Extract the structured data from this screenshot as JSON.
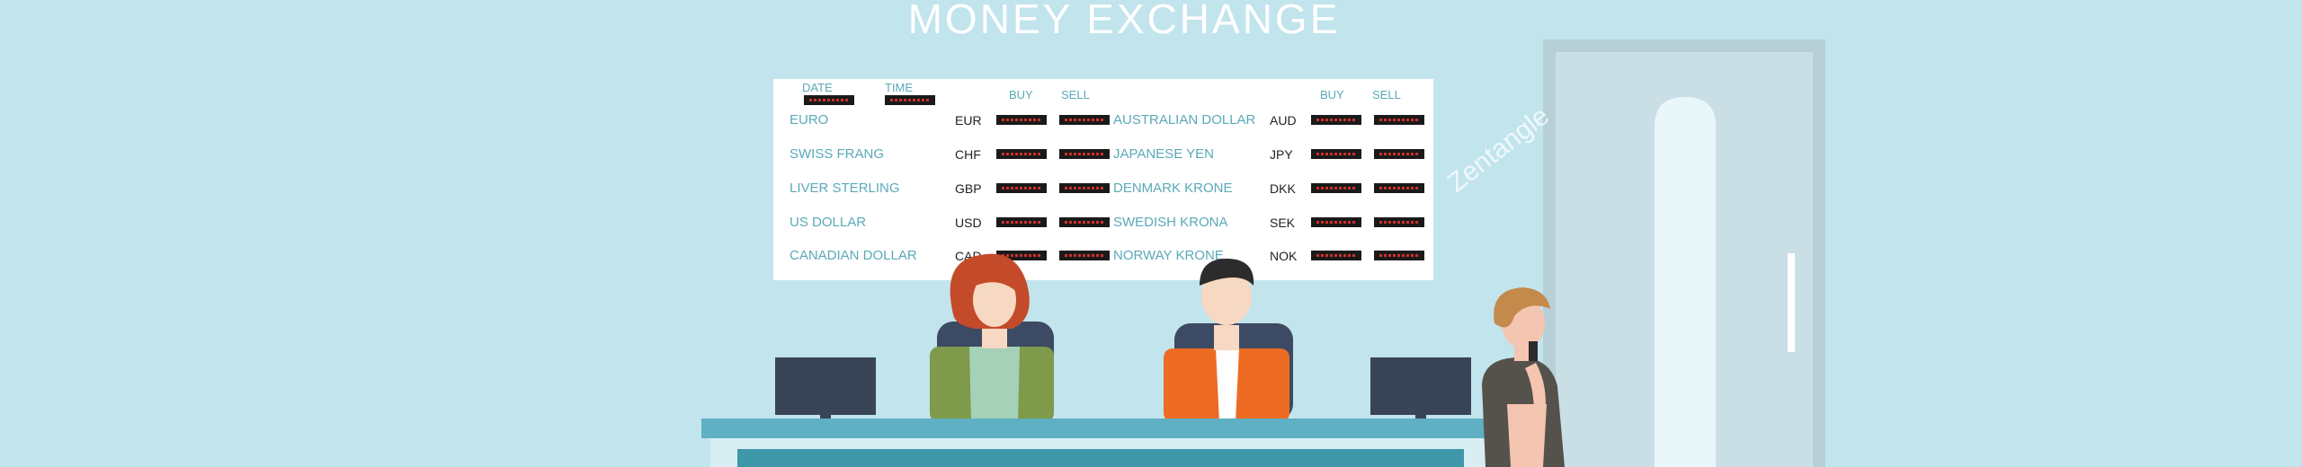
{
  "title": "MONEY EXCHANGE",
  "watermark": "Zentangle",
  "board": {
    "date_label": "DATE",
    "time_label": "TIME",
    "buy_label": "BUY",
    "sell_label": "SELL",
    "left_rows": [
      {
        "name": "EURO",
        "code": "EUR"
      },
      {
        "name": "SWISS FRANG",
        "code": "CHF"
      },
      {
        "name": "LIVER STERLING",
        "code": "GBP"
      },
      {
        "name": "US DOLLAR",
        "code": "USD"
      },
      {
        "name": "CANADIAN DOLLAR",
        "code": "CAD"
      }
    ],
    "right_rows": [
      {
        "name": "AUSTRALIAN DOLLAR",
        "code": "AUD"
      },
      {
        "name": "JAPANESE YEN",
        "code": "JPY"
      },
      {
        "name": "DENMARK KRONE",
        "code": "DKK"
      },
      {
        "name": "SWEDISH KRONA",
        "code": "SEK"
      },
      {
        "name": "NORWAY KRONE",
        "code": "NOK"
      }
    ]
  },
  "colors": {
    "background": "#c1e4ed",
    "board": "#ffffff",
    "label_text": "#5aa9b8",
    "counter_top": "#5fb0c2",
    "door": "#b7cfd6"
  }
}
